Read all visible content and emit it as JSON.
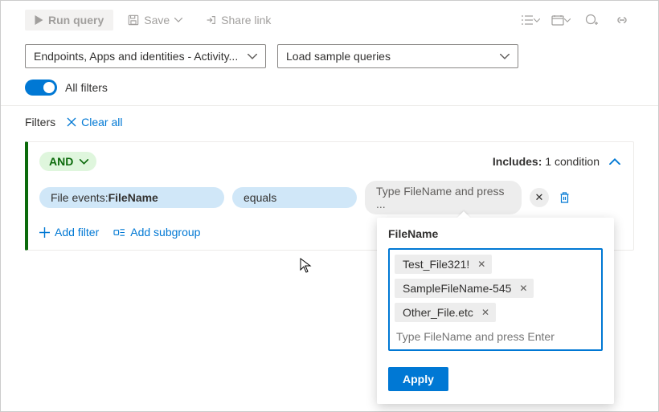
{
  "toolbar": {
    "run": "Run query",
    "save": "Save",
    "share": "Share link"
  },
  "dropdowns": {
    "scope": "Endpoints, Apps and identities - Activity...",
    "samples": "Load sample queries"
  },
  "toggle": {
    "label": "All filters"
  },
  "filtersHead": {
    "label": "Filters",
    "clear": "Clear all"
  },
  "card": {
    "op": "AND",
    "includesLabel": "Includes:",
    "includesCount": "1 condition",
    "field_prefix": "File events: ",
    "field_name": "FileName",
    "comparator": "equals",
    "value_placeholder": "Type FileName and press ...",
    "addFilter": "Add filter",
    "addSubgroup": "Add subgroup"
  },
  "popover": {
    "title": "FileName",
    "tags": [
      "Test_File321!",
      "SampleFileName-545",
      "Other_File.etc"
    ],
    "input_placeholder": "Type FileName and press Enter",
    "apply": "Apply"
  }
}
